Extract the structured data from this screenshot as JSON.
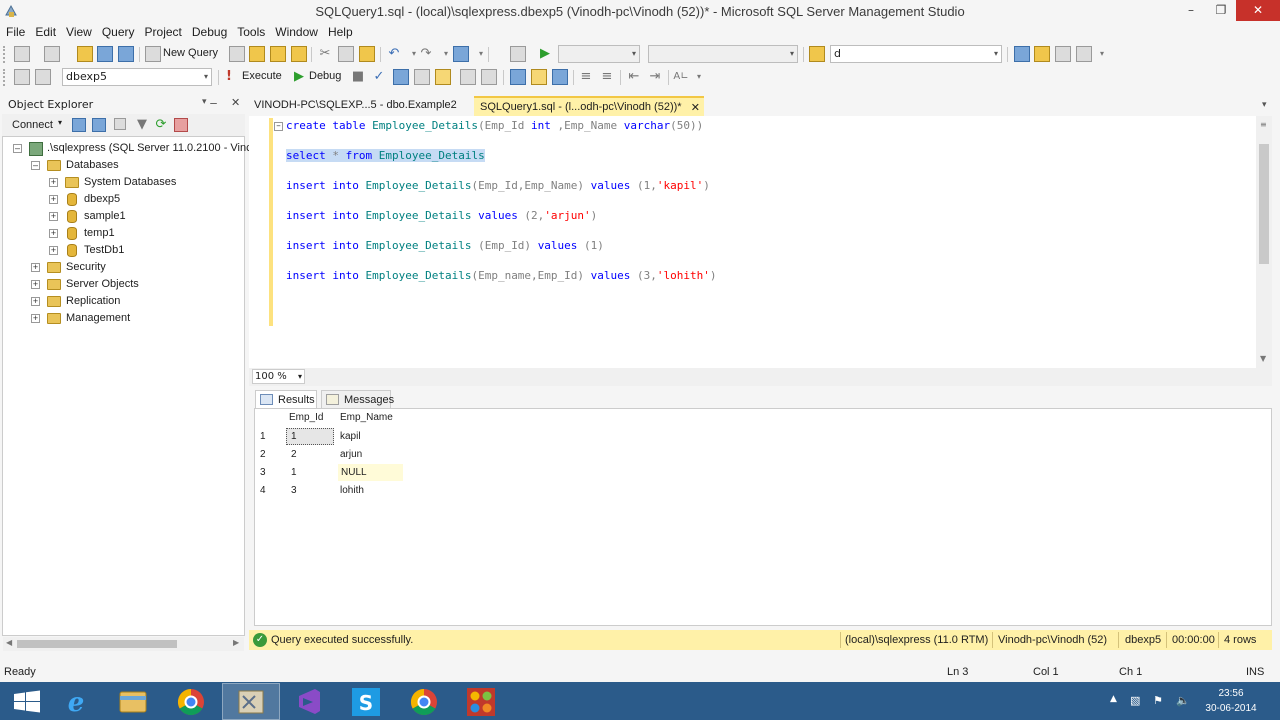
{
  "window": {
    "title": "SQLQuery1.sql - (local)\\sqlexpress.dbexp5 (Vinodh-pc\\Vinodh (52))* - Microsoft SQL Server Management Studio"
  },
  "menu": [
    "File",
    "Edit",
    "View",
    "Query",
    "Project",
    "Debug",
    "Tools",
    "Window",
    "Help"
  ],
  "toolbar": {
    "new_query": "New Query",
    "search_value": "d",
    "database": "dbexp5",
    "execute": "Execute",
    "debug": "Debug"
  },
  "object_explorer": {
    "title": "Object Explorer",
    "connect": "Connect",
    "server": ".\\sqlexpress (SQL Server 11.0.2100 - Vinc",
    "databases_label": "Databases",
    "databases": [
      "System Databases",
      "dbexp5",
      "sample1",
      "temp1",
      "TestDb1"
    ],
    "folders": [
      "Security",
      "Server Objects",
      "Replication",
      "Management"
    ]
  },
  "tabs": {
    "table_tab": "VINODH-PC\\SQLEXP...5 - dbo.Example2",
    "query_tab": "SQLQuery1.sql - (l...odh-pc\\Vinodh (52))*"
  },
  "editor": {
    "line1": {
      "kw1": "create table ",
      "obj": "Employee_Details",
      "rest": "(Emp_Id ",
      "kw2": "int",
      "rest2": " ,Emp_Name ",
      "kw3": "varchar",
      "rest3": "(50))"
    },
    "line2": {
      "kw1": "select",
      "mid": " * ",
      "kw2": "from",
      "obj": " Employee_Details"
    },
    "line3": {
      "kw1": "insert into ",
      "obj": "Employee_Details",
      "cols": "(Emp_Id,Emp_Name) ",
      "kw2": "values",
      "vals_a": " (1,",
      "str": "'kapil'",
      "vals_b": ")"
    },
    "line4": {
      "kw1": "insert into ",
      "obj": "Employee_Details",
      "kw2": " values",
      "vals_a": " (2,",
      "str": "'arjun'",
      "vals_b": ")"
    },
    "line5": {
      "kw1": "insert into ",
      "obj": "Employee_Details",
      "cols": " (Emp_Id) ",
      "kw2": "values",
      "vals_a": " (1)"
    },
    "line6": {
      "kw1": "insert into ",
      "obj": "Employee_Details",
      "cols": "(Emp_name,Emp_Id) ",
      "kw2": "values",
      "vals_a": " (3,",
      "str": "'lohith'",
      "vals_b": ")"
    },
    "zoom": "100 %"
  },
  "results": {
    "tabs": {
      "results": "Results",
      "messages": "Messages"
    },
    "columns": [
      "Emp_Id",
      "Emp_Name"
    ],
    "rows": [
      {
        "n": "1",
        "id": "1",
        "name": "kapil"
      },
      {
        "n": "2",
        "id": "2",
        "name": "arjun"
      },
      {
        "n": "3",
        "id": "1",
        "name": "NULL"
      },
      {
        "n": "4",
        "id": "3",
        "name": "lohith"
      }
    ]
  },
  "status": {
    "message": "Query executed successfully.",
    "server": "(local)\\sqlexpress (11.0 RTM)",
    "user": "Vinodh-pc\\Vinodh (52)",
    "database": "dbexp5",
    "elapsed": "00:00:00",
    "rows": "4 rows"
  },
  "app_status": {
    "state": "Ready",
    "ln": "Ln 3",
    "col": "Col 1",
    "ch": "Ch 1",
    "mode": "INS"
  },
  "clock": {
    "time": "23:56",
    "date": "30-06-2014"
  },
  "colors": {
    "accent_tab": "#fff1a8",
    "taskbar": "#2b5b8a",
    "close_button": "#c7312a",
    "success": "#3a9a3a"
  },
  "icons": [
    "ssms-app-icon",
    "windows-start-icon",
    "ie-icon",
    "explorer-icon",
    "chrome-icon",
    "ssms-taskbar-icon",
    "visual-studio-icon",
    "skype-icon",
    "apps-icon",
    "flag-icon",
    "network-icon",
    "volume-icon"
  ]
}
